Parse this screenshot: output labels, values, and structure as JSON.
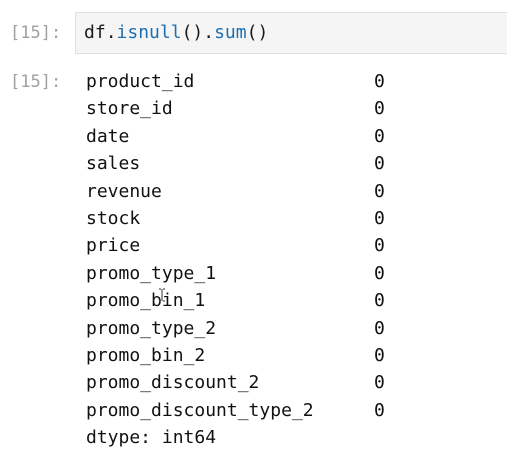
{
  "input_cell": {
    "prompt": "[15]:",
    "code": {
      "obj": "df",
      "dot1": ".",
      "fn1": "isnull",
      "paren1": "()",
      "dot2": ".",
      "fn2": "sum",
      "paren2": "()"
    }
  },
  "output_cell": {
    "prompt": "[15]:",
    "rows": [
      {
        "name": "product_id",
        "value": "0"
      },
      {
        "name": "store_id",
        "value": "0"
      },
      {
        "name": "date",
        "value": "0"
      },
      {
        "name": "sales",
        "value": "0"
      },
      {
        "name": "revenue",
        "value": "0"
      },
      {
        "name": "stock",
        "value": "0"
      },
      {
        "name": "price",
        "value": "0"
      },
      {
        "name": "promo_type_1",
        "value": "0"
      },
      {
        "name": "promo_bin_1",
        "value": "0"
      },
      {
        "name": "promo_type_2",
        "value": "0"
      },
      {
        "name": "promo_bin_2",
        "value": "0"
      },
      {
        "name": "promo_discount_2",
        "value": "0"
      },
      {
        "name": "promo_discount_type_2",
        "value": "0"
      }
    ],
    "dtype": "dtype: int64"
  },
  "colors": {
    "prompt": "#a0a0a0",
    "function": "#1f6fb0",
    "input_background": "#f5f5f5"
  },
  "icons": {
    "cursor": "text-cursor-icon"
  }
}
